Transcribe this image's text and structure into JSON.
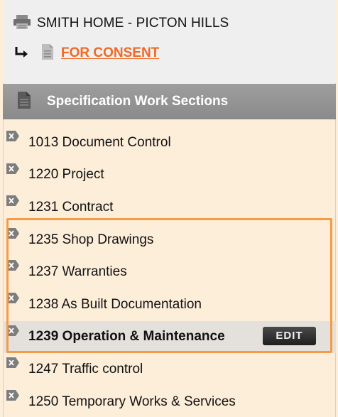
{
  "project": {
    "title": "SMITH HOME - PICTON HILLS",
    "icon": "printer-icon"
  },
  "subproject": {
    "link_label": "FOR CONSENT",
    "arrow_icon": "return-arrow-icon",
    "doc_icon": "document-icon"
  },
  "section_header": {
    "title": "Specification Work Sections",
    "icon": "document-icon"
  },
  "sections": [
    {
      "label": "1013 Document Control"
    },
    {
      "label": "1220 Project"
    },
    {
      "label": "1231 Contract"
    },
    {
      "label": "1235 Shop Drawings"
    },
    {
      "label": "1237 Warranties"
    },
    {
      "label": "1238 As Built Documentation"
    },
    {
      "label": "1239 Operation & Maintenance",
      "active": true,
      "edit_label": "EDIT"
    },
    {
      "label": "1247 Traffic control"
    },
    {
      "label": "1250 Temporary Works & Services"
    }
  ],
  "colors": {
    "accent": "#ee6a26",
    "highlight": "#f59b45",
    "list_bg": "#fdeeda",
    "header_bg": "#8f8f8f"
  }
}
